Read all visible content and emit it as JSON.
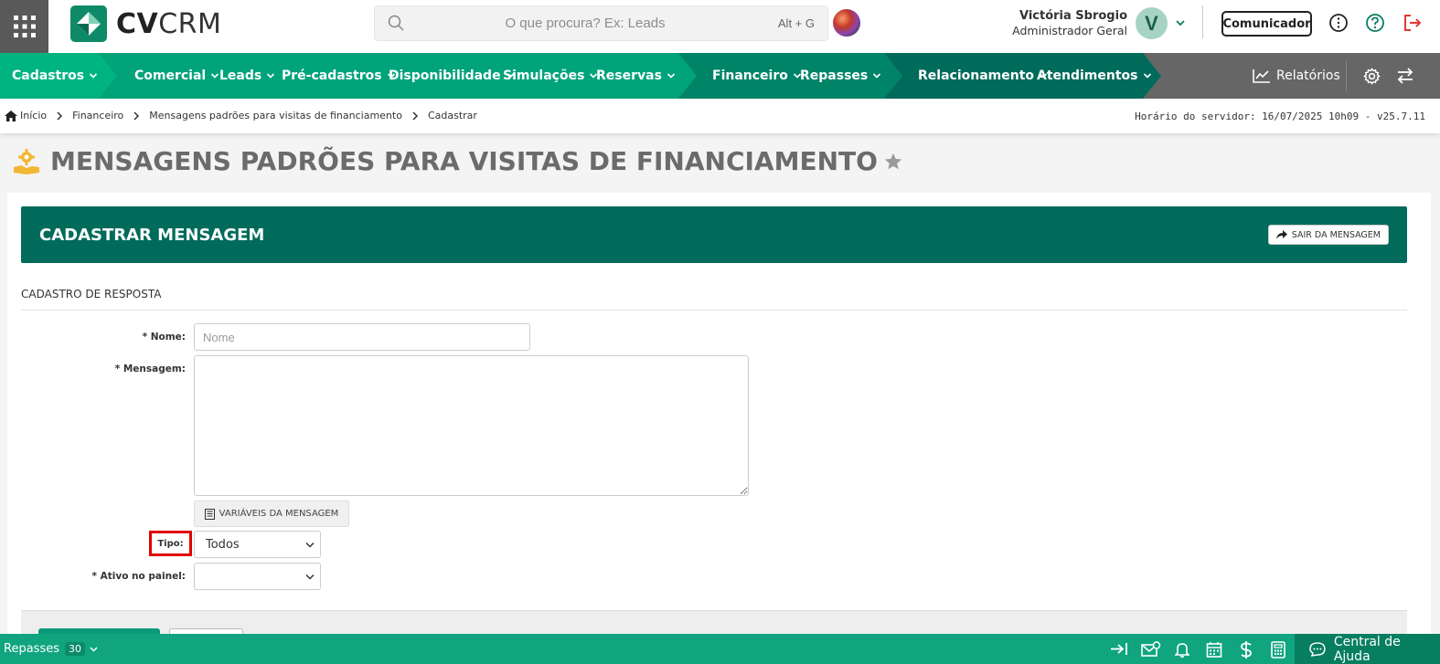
{
  "app": {
    "logo_bold": "CV",
    "logo_light": "CRM"
  },
  "search": {
    "placeholder": "O que procura? Ex: Leads",
    "shortcut": "Alt + G"
  },
  "user": {
    "name": "Victória Sbrogio",
    "role": "Administrador Geral",
    "initial": "V"
  },
  "header": {
    "comunicador_label": "Comunicador"
  },
  "nav": {
    "items": [
      {
        "label": "Cadastros"
      },
      {
        "label": "Comercial"
      },
      {
        "label": "Leads"
      },
      {
        "label": "Pré-cadastros"
      },
      {
        "label": "Disponibilidade"
      },
      {
        "label": "Simulações"
      },
      {
        "label": "Reservas"
      },
      {
        "label": "Financeiro"
      },
      {
        "label": "Repasses"
      },
      {
        "label": "Relacionamento"
      },
      {
        "label": "Atendimentos"
      }
    ],
    "reports_label": "Relatórios"
  },
  "breadcrumb": {
    "items": [
      "Início",
      "Financeiro",
      "Mensagens padrões para visitas de financiamento",
      "Cadastrar"
    ],
    "server_time": "Horário do servidor: 16/07/2025 10h09 - v25.7.11"
  },
  "page": {
    "title": "MENSAGENS PADRÕES PARA VISITAS DE FINANCIAMENTO"
  },
  "form": {
    "card_title": "CADASTRAR MENSAGEM",
    "exit_label": "SAIR DA MENSAGEM",
    "section_title": "CADASTRO DE RESPOSTA",
    "nome_label": "* Nome:",
    "nome_placeholder": "Nome",
    "nome_value": "",
    "mensagem_label": "* Mensagem:",
    "mensagem_value": "",
    "variables_label": "VARIÁVEIS DA MENSAGEM",
    "tipo_label": "Tipo:",
    "tipo_value": "Todos",
    "ativo_label": "* Ativo no painel:",
    "ativo_value": ""
  },
  "footer": {
    "module_label": "Repasses",
    "module_count": "30",
    "help_label": "Central de Ajuda"
  },
  "colors": {
    "nav_green": "#00a37a",
    "dark_green": "#006b5a",
    "footer_green": "#10a57e",
    "highlight_red": "#e00000",
    "logout_red": "#e53935"
  }
}
